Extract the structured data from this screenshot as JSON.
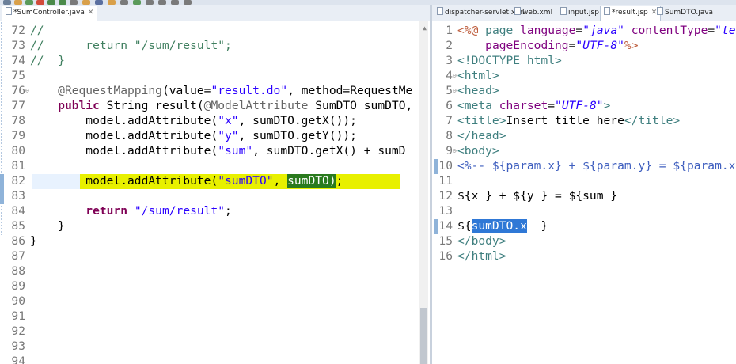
{
  "left_editor": {
    "tabs": [
      {
        "label": "*SumController.java",
        "active": true
      }
    ],
    "lines": [
      {
        "n": "72",
        "html": "<span class='cmt'>//</span>"
      },
      {
        "n": "73",
        "html": "<span class='cmt'>//      return \"/sum/result\";</span>"
      },
      {
        "n": "74",
        "html": "<span class='cmt'>//  }</span>"
      },
      {
        "n": "75",
        "html": ""
      },
      {
        "n": "76",
        "fold": "⊖",
        "html": "    <span class='ann'>@RequestMapping</span>(value=<span class='str'>\"result.do\"</span>, method=RequestMe"
      },
      {
        "n": "77",
        "html": "    <span class='kw'>public</span> String result(<span class='ann'>@ModelAttribute</span> SumDTO sumDTO,"
      },
      {
        "n": "78",
        "html": "        model.addAttribute(<span class='str'>\"x\"</span>, sumDTO.getX());"
      },
      {
        "n": "79",
        "html": "        model.addAttribute(<span class='str'>\"y\"</span>, sumDTO.getY());"
      },
      {
        "n": "80",
        "html": "        model.addAttribute(<span class='str'>\"sum\"</span>, sumDTO.getX() + sumD"
      },
      {
        "n": "81",
        "html": ""
      },
      {
        "n": "82",
        "html": "        model.addAttribute(<span class='str'>\"sumDTO\"</span>, <span class='sel-green'>sumDTO)</span>;"
      },
      {
        "n": "83",
        "html": ""
      },
      {
        "n": "84",
        "html": "        <span class='kw'>return</span> <span class='str'>\"/sum/result\"</span>;"
      },
      {
        "n": "85",
        "html": "    }"
      },
      {
        "n": "86",
        "html": "}"
      },
      {
        "n": "87",
        "html": ""
      },
      {
        "n": "88",
        "html": ""
      },
      {
        "n": "89",
        "html": ""
      },
      {
        "n": "90",
        "html": ""
      },
      {
        "n": "91",
        "html": ""
      },
      {
        "n": "92",
        "html": ""
      },
      {
        "n": "93",
        "html": ""
      },
      {
        "n": "94",
        "html": ""
      }
    ]
  },
  "right_editor": {
    "tabs": [
      {
        "label": "dispatcher-servlet.xml",
        "active": false
      },
      {
        "label": "web.xml",
        "active": false
      },
      {
        "label": "input.jsp",
        "active": false
      },
      {
        "label": "*result.jsp",
        "active": true
      },
      {
        "label": "SumDTO.java",
        "active": false
      }
    ],
    "lines": [
      {
        "n": "1",
        "html": "<span class='jsp'>&lt;%@</span> <span class='tag'>page</span> <span class='attr'>language</span>=<span class='aval'>\"java\"</span> <span class='attr'>contentType</span>=<span class='aval'>\"te</span>"
      },
      {
        "n": "2",
        "html": "    <span class='attr'>pageEncoding</span>=<span class='aval'>\"UTF-8\"</span><span class='jsp'>%&gt;</span>"
      },
      {
        "n": "3",
        "html": "<span class='tag'>&lt;!DOCTYPE html&gt;</span>"
      },
      {
        "n": "4",
        "fold": "⊖",
        "html": "<span class='tag'>&lt;html&gt;</span>"
      },
      {
        "n": "5",
        "fold": "⊖",
        "html": "<span class='tag'>&lt;head&gt;</span>"
      },
      {
        "n": "6",
        "html": "<span class='tag'>&lt;meta</span> <span class='attr'>charset</span>=<span class='aval'>\"UTF-8\"</span><span class='tag'>&gt;</span>"
      },
      {
        "n": "7",
        "html": "<span class='tag'>&lt;title&gt;</span>Insert title here<span class='tag'>&lt;/title&gt;</span>"
      },
      {
        "n": "8",
        "html": "<span class='tag'>&lt;/head&gt;</span>"
      },
      {
        "n": "9",
        "fold": "⊖",
        "html": "<span class='tag'>&lt;body&gt;</span>"
      },
      {
        "n": "10",
        "html": "<span class='jspc'>&lt;%-- ${param.x} + ${param.y} = ${param.x</span>"
      },
      {
        "n": "11",
        "html": ""
      },
      {
        "n": "12",
        "html": "${x } + ${y } = ${sum }"
      },
      {
        "n": "13",
        "html": ""
      },
      {
        "n": "14",
        "html": "${<span class='sel-blue'>sumDTO.x</span>  }"
      },
      {
        "n": "15",
        "html": "<span class='tag'>&lt;/body&gt;</span>"
      },
      {
        "n": "16",
        "html": "<span class='tag'>&lt;/html&gt;</span>"
      }
    ]
  },
  "colors": {
    "line_highlight": "#e8f000",
    "selection_green": "#2a7a1e",
    "selection_blue": "#2f78d6",
    "keyword": "#7f0055",
    "string": "#2a00ff",
    "comment": "#3f7f5f"
  }
}
